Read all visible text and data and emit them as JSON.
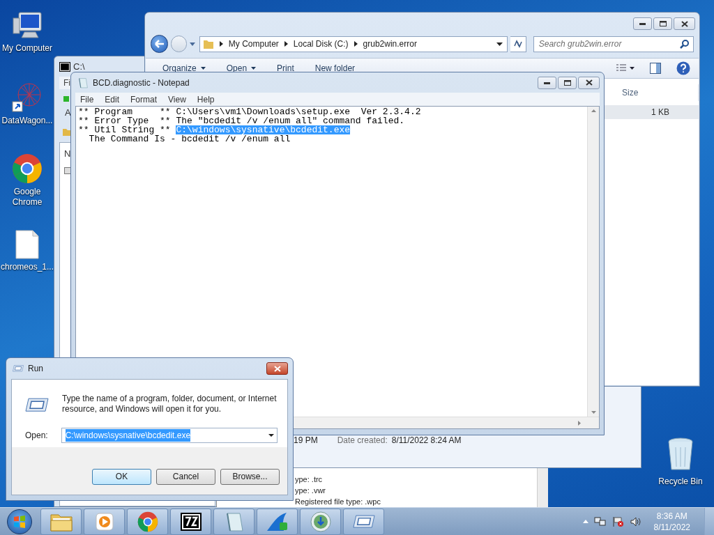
{
  "desktop_icons": [
    {
      "label": "My Computer",
      "kind": "computer"
    },
    {
      "label": "DataWagon...",
      "kind": "network"
    },
    {
      "label": "Google Chrome",
      "kind": "chrome"
    },
    {
      "label": "chromeos_1...",
      "kind": "file"
    }
  ],
  "recycle_bin": {
    "label": "Recycle Bin"
  },
  "explorer": {
    "breadcrumbs": [
      "My Computer",
      "Local Disk (C:)",
      "grub2win.error"
    ],
    "search": {
      "placeholder": "Search grub2win.error"
    },
    "toolbar": [
      {
        "label": "Organize",
        "dropdown": true
      },
      {
        "label": "Open",
        "dropdown": true
      },
      {
        "label": "Print",
        "dropdown": false
      },
      {
        "label": "New folder",
        "dropdown": false
      }
    ],
    "columns": [
      "Size"
    ],
    "rows": [
      {
        "size": "1 KB",
        "selected": true
      }
    ]
  },
  "details_pane": {
    "modified": "19 PM",
    "created_label": "Date created:",
    "created": "8/11/2022 8:24 AM"
  },
  "sevenzip": {
    "title": "C:\\",
    "menu": "Fi",
    "toolbar_text": "A",
    "column": "N"
  },
  "file_list": [
    "ype: .trc",
    "ype: .vwr",
    "Registered file type: .wpc"
  ],
  "notepad": {
    "title": "BCD.diagnostic - Notepad",
    "menu": [
      "File",
      "Edit",
      "Format",
      "View",
      "Help"
    ],
    "lines": [
      [
        {
          "text": "** Program     ** C:\\Users\\vm1\\Downloads\\setup.exe  Ver 2.3.4.2",
          "selected": false
        }
      ],
      [
        {
          "text": "** Error Type  ** The \"bcdedit /v /enum all\" command failed.",
          "selected": false
        }
      ],
      [
        {
          "text": "** Util String ** ",
          "selected": false
        },
        {
          "text": "C:\\windows\\sysnative\\bcdedit.exe",
          "selected": true
        }
      ],
      [
        {
          "text": "  The Command Is - bcdedit /v /enum all",
          "selected": false
        }
      ]
    ]
  },
  "run": {
    "title": "Run",
    "message": "Type the name of a program, folder, document, or Internet resource, and Windows will open it for you.",
    "open_label": "Open:",
    "value": "C:\\windows\\sysnative\\bcdedit.exe",
    "value_selected": true,
    "buttons": [
      {
        "label": "OK",
        "default": true
      },
      {
        "label": "Cancel",
        "default": false
      },
      {
        "label": "Browse...",
        "default": false
      }
    ]
  },
  "taskbar": {
    "apps": [
      {
        "kind": "explorer"
      },
      {
        "kind": "media"
      },
      {
        "kind": "chrome"
      },
      {
        "kind": "sevenzip"
      },
      {
        "kind": "notepad"
      },
      {
        "kind": "shark"
      },
      {
        "kind": "globe"
      },
      {
        "kind": "run"
      }
    ],
    "clock": {
      "time": "8:36 AM",
      "date": "8/11/2022"
    }
  }
}
